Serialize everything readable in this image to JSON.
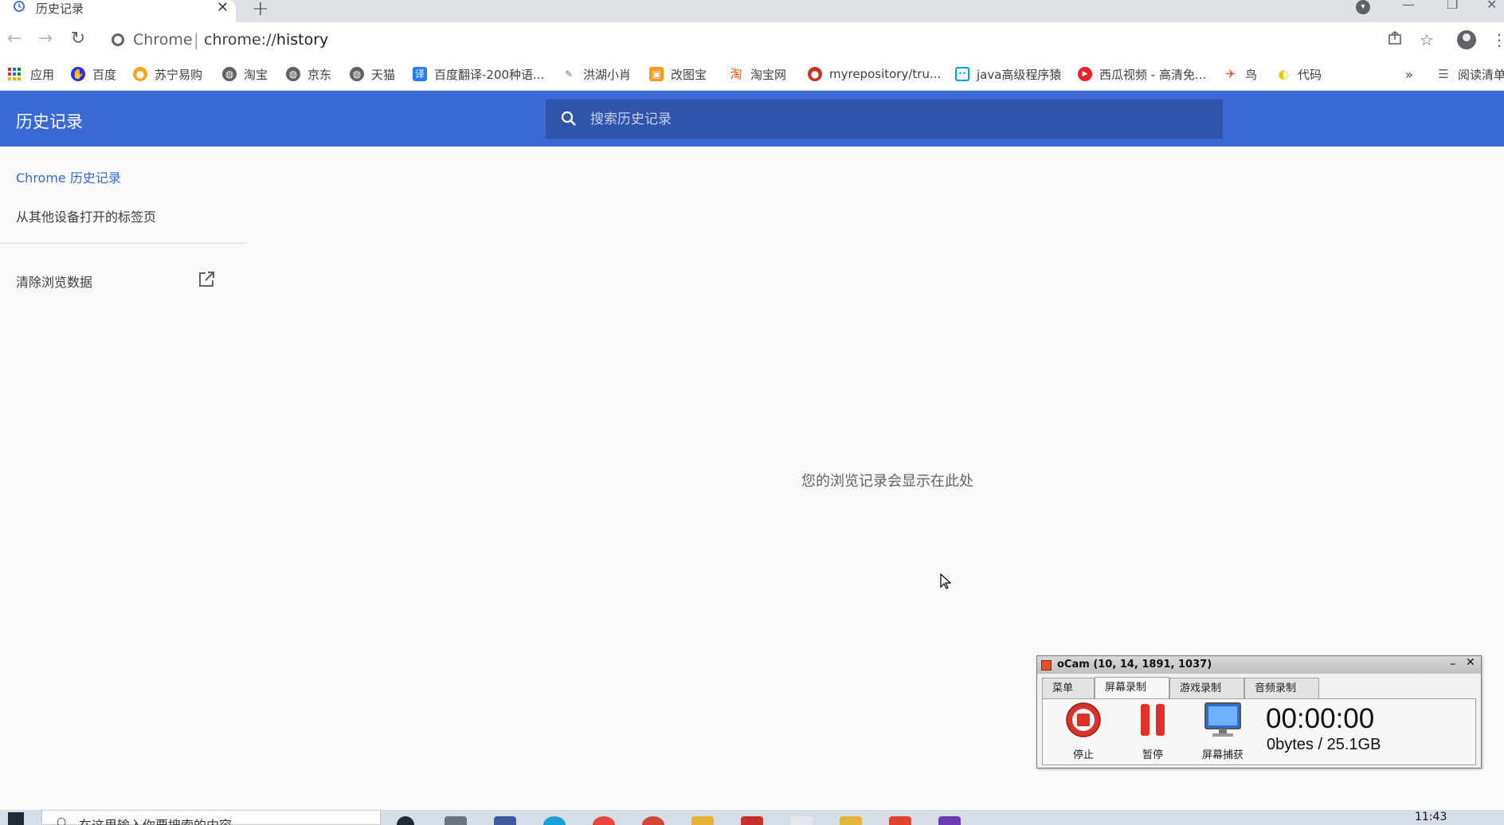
{
  "tab": {
    "title": "历史记录",
    "close": "✕",
    "new_tab": "+"
  },
  "window": {
    "minimize": "—",
    "maximize": "❐",
    "close": "✕"
  },
  "omnibox": {
    "host": "Chrome",
    "separator": "|",
    "scheme": "chrome://",
    "path": "history"
  },
  "bookmarks": {
    "items": [
      {
        "label": "应用",
        "icon": "apps-icon"
      },
      {
        "label": "百度",
        "icon": "baidu-icon",
        "color": "#2932e1"
      },
      {
        "label": "苏宁易购",
        "icon": "suning-icon",
        "color": "#f5a623"
      },
      {
        "label": "淘宝",
        "icon": "globe-icon"
      },
      {
        "label": "京东",
        "icon": "globe-icon"
      },
      {
        "label": "天猫",
        "icon": "globe-icon"
      },
      {
        "label": "百度翻译-200种语...",
        "icon": "translate-icon",
        "color": "#2a7cf6"
      },
      {
        "label": "洪湖小肖",
        "icon": "feather-icon",
        "color": "#7a7a7a"
      },
      {
        "label": "改图宝",
        "icon": "gaitubao-icon",
        "color": "#f29c1f"
      },
      {
        "label": "淘宝网",
        "icon": "taobao-icon",
        "color": "#ff5000"
      },
      {
        "label": "myrepository/tru...",
        "icon": "repo-icon",
        "color": "#c0392b"
      },
      {
        "label": "java高级程序猿",
        "icon": "bilibili-icon",
        "color": "#00a1d6"
      },
      {
        "label": "西瓜视频 - 高清免...",
        "icon": "xigua-icon",
        "color": "#e3242b"
      },
      {
        "label": "鸟",
        "icon": "bird-icon",
        "color": "#e74c3c"
      },
      {
        "label": "代码",
        "icon": "code-icon",
        "color": "#f1c40f"
      }
    ],
    "overflow": "»",
    "reading_list": "阅读清单"
  },
  "header": {
    "title": "历史记录",
    "search_placeholder": "搜索历史记录"
  },
  "sidebar": {
    "items": [
      {
        "label": "Chrome 历史记录",
        "active": true
      },
      {
        "label": "从其他设备打开的标签页",
        "active": false
      }
    ],
    "clear_data": "清除浏览数据"
  },
  "main": {
    "empty_message": "您的浏览记录会显示在此处"
  },
  "ocam": {
    "title": "oCam (10, 14, 1891, 1037)",
    "tabs": [
      "菜单",
      "屏幕录制",
      "游戏录制",
      "音频录制"
    ],
    "active_tab": "屏幕录制",
    "buttons": {
      "stop": "停止",
      "pause": "暂停",
      "capture": "屏幕捕获"
    },
    "time": "00:00:00",
    "size": "0bytes / 25.1GB"
  },
  "taskbar": {
    "search_placeholder": "在这里输入你要搜索的内容",
    "clock": "11:43"
  },
  "colors": {
    "accent": "#3b69d4",
    "search_bg": "#2e55aa",
    "ocam_red": "#d9342b"
  }
}
